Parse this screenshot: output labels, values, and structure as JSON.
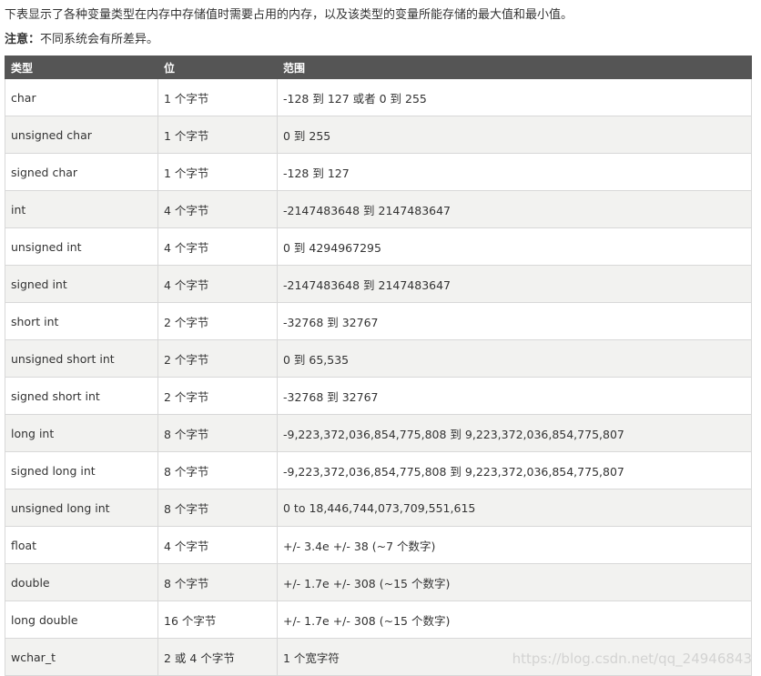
{
  "intro_text": "下表显示了各种变量类型在内存中存储值时需要占用的内存，以及该类型的变量所能存储的最大值和最小值。",
  "note": {
    "label": "注意：",
    "text": "不同系统会有所差异。"
  },
  "table": {
    "headers": [
      "类型",
      "位",
      "范围"
    ],
    "rows": [
      [
        "char",
        "1 个字节",
        "-128 到 127 或者 0 到 255"
      ],
      [
        "unsigned char",
        "1 个字节",
        "0 到 255"
      ],
      [
        "signed char",
        "1 个字节",
        "-128 到 127"
      ],
      [
        "int",
        "4 个字节",
        "-2147483648 到 2147483647"
      ],
      [
        "unsigned int",
        "4 个字节",
        "0 到 4294967295"
      ],
      [
        "signed int",
        "4 个字节",
        "-2147483648 到 2147483647"
      ],
      [
        "short int",
        "2 个字节",
        "-32768 到 32767"
      ],
      [
        "unsigned short int",
        "2 个字节",
        "0 到 65,535"
      ],
      [
        "signed short int",
        "2 个字节",
        "-32768 到 32767"
      ],
      [
        "long int",
        "8 个字节",
        "-9,223,372,036,854,775,808 到 9,223,372,036,854,775,807"
      ],
      [
        "signed long int",
        "8 个字节",
        "-9,223,372,036,854,775,808 到 9,223,372,036,854,775,807"
      ],
      [
        "unsigned long int",
        "8 个字节",
        "0 to 18,446,744,073,709,551,615"
      ],
      [
        "float",
        "4 个字节",
        "+/- 3.4e +/- 38 (~7 个数字)"
      ],
      [
        "double",
        "8 个字节",
        "+/- 1.7e +/- 308 (~15 个数字)"
      ],
      [
        "long double",
        "16 个字节",
        "+/- 1.7e +/- 308 (~15 个数字)"
      ],
      [
        "wchar_t",
        "2 或 4 个字节",
        "1 个宽字符"
      ]
    ]
  },
  "watermark": "https://blog.csdn.net/qq_24946843"
}
